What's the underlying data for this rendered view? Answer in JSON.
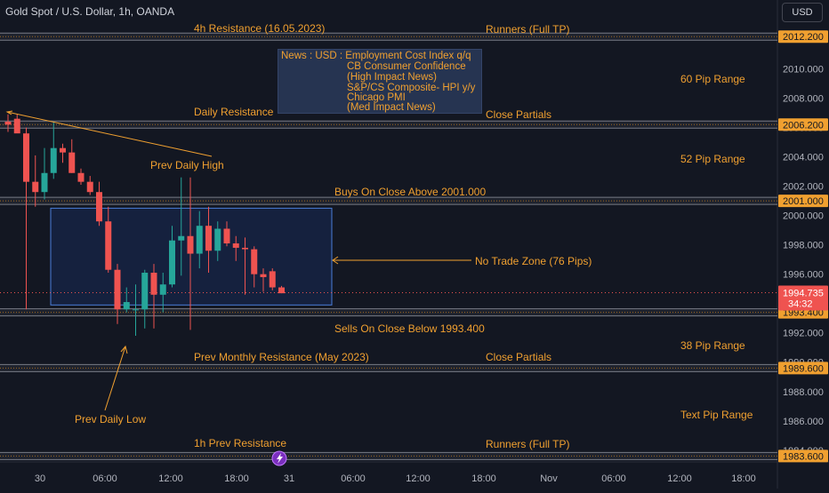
{
  "header": {
    "title": "Gold Spot / U.S. Dollar, 1h, OANDA",
    "currency_button": "USD"
  },
  "colors": {
    "background": "#131722",
    "bull": "#26a69a",
    "bear": "#ef5350",
    "annotation": "#f0a030",
    "zone_line": "#787b86",
    "no_trade_zone": "#2962ff",
    "price_label": "#f0a030",
    "current_price_label": "#ef5350"
  },
  "chart_data": {
    "type": "candlestick",
    "symbol": "Gold Spot / U.S. Dollar",
    "timeframe": "1h",
    "ylim": [
      1983.2,
      2013.0
    ],
    "y_ticks": [
      "2010.000",
      "2008.000",
      "2006.000",
      "2004.000",
      "2002.000",
      "2000.000",
      "1998.000",
      "1996.000",
      "1994.000",
      "1992.000",
      "1990.000",
      "1988.000",
      "1986.000",
      "1984.000"
    ],
    "x_ticks": [
      "30",
      "06:00",
      "12:00",
      "18:00",
      "31",
      "06:00",
      "12:00",
      "18:00",
      "Nov",
      "06:00",
      "12:00",
      "18:00"
    ],
    "price_levels": [
      {
        "price": 2012.2,
        "label": "2012.200"
      },
      {
        "price": 2006.2,
        "label": "2006.200"
      },
      {
        "price": 2001.0,
        "label": "2001.000"
      },
      {
        "price": 1993.4,
        "label": "1993.400"
      },
      {
        "price": 1989.6,
        "label": "1989.600"
      },
      {
        "price": 1983.6,
        "label": "1983.600"
      }
    ],
    "current_price": {
      "price": 1994.735,
      "label": "1994.735",
      "countdown": "34:32"
    },
    "candles": [
      {
        "o": 2006.4,
        "h": 2006.9,
        "l": 2005.7,
        "c": 2006.2
      },
      {
        "o": 2006.6,
        "h": 2006.9,
        "l": 2005.9,
        "c": 2005.6
      },
      {
        "o": 2005.6,
        "h": 2006.0,
        "l": 1993.6,
        "c": 2002.3
      },
      {
        "o": 2002.3,
        "h": 2004.1,
        "l": 2000.6,
        "c": 2001.6
      },
      {
        "o": 2001.6,
        "h": 2004.6,
        "l": 2001.1,
        "c": 2002.9
      },
      {
        "o": 2002.9,
        "h": 2006.4,
        "l": 2002.5,
        "c": 2004.6
      },
      {
        "o": 2004.6,
        "h": 2004.9,
        "l": 2003.6,
        "c": 2004.3
      },
      {
        "o": 2004.3,
        "h": 2005.2,
        "l": 2002.9,
        "c": 2002.9
      },
      {
        "o": 2002.9,
        "h": 2003.2,
        "l": 2002.1,
        "c": 2002.3
      },
      {
        "o": 2002.3,
        "h": 2002.7,
        "l": 2001.4,
        "c": 2001.6
      },
      {
        "o": 2001.6,
        "h": 2002.3,
        "l": 1999.3,
        "c": 1999.6
      },
      {
        "o": 1999.6,
        "h": 2000.6,
        "l": 1996.1,
        "c": 1996.3
      },
      {
        "o": 1996.3,
        "h": 1996.7,
        "l": 1992.6,
        "c": 1993.6
      },
      {
        "o": 1993.6,
        "h": 1995.1,
        "l": 1993.4,
        "c": 1994.1
      },
      {
        "o": 1993.6,
        "h": 1995.3,
        "l": 1991.8,
        "c": 1993.6
      },
      {
        "o": 1993.6,
        "h": 1996.3,
        "l": 1992.3,
        "c": 1996.1
      },
      {
        "o": 1996.1,
        "h": 1996.7,
        "l": 1992.3,
        "c": 1994.6
      },
      {
        "o": 1994.6,
        "h": 1996.1,
        "l": 1993.4,
        "c": 1995.3
      },
      {
        "o": 1995.3,
        "h": 1999.3,
        "l": 1995.1,
        "c": 1998.3
      },
      {
        "o": 1998.3,
        "h": 2002.6,
        "l": 1995.9,
        "c": 1998.6
      },
      {
        "o": 1998.6,
        "h": 2002.6,
        "l": 1992.2,
        "c": 1997.4
      },
      {
        "o": 1997.4,
        "h": 2000.3,
        "l": 1996.4,
        "c": 1999.3
      },
      {
        "o": 1999.3,
        "h": 2000.6,
        "l": 1996.1,
        "c": 1997.6
      },
      {
        "o": 1997.6,
        "h": 1999.6,
        "l": 1996.9,
        "c": 1999.1
      },
      {
        "o": 1999.1,
        "h": 1999.6,
        "l": 1997.9,
        "c": 1998.1
      },
      {
        "o": 1998.1,
        "h": 1998.6,
        "l": 1996.9,
        "c": 1997.8
      },
      {
        "o": 1997.8,
        "h": 1998.5,
        "l": 1994.6,
        "c": 1997.7
      },
      {
        "o": 1997.7,
        "h": 1997.9,
        "l": 1995.1,
        "c": 1996.0
      },
      {
        "o": 1996.0,
        "h": 1996.4,
        "l": 1994.8,
        "c": 1995.8
      },
      {
        "o": 1996.2,
        "h": 1996.4,
        "l": 1994.9,
        "c": 1995.1
      },
      {
        "o": 1995.1,
        "h": 1995.2,
        "l": 1994.7,
        "c": 1994.7
      }
    ]
  },
  "annotations": {
    "res_4h": "4h Resistance (16.05.2023)",
    "runners_top": "Runners (Full TP)",
    "daily_resistance": "Daily Resistance",
    "close_partials_top": "Close Partials",
    "pip_range_60": "60 Pip Range",
    "prev_daily_high": "Prev Daily High",
    "pip_range_52": "52 Pip Range",
    "buys_on_close": "Buys On Close Above 2001.000",
    "no_trade_zone": "No Trade Zone (76 Pips)",
    "sells_on_close": "Sells On Close Below 1993.400",
    "pip_range_38": "38 Pip Range",
    "prev_monthly_res": "Prev Monthly Resistance (May 2023)",
    "close_partials_bottom": "Close Partials",
    "prev_daily_low": "Prev Daily Low",
    "text_pip_range": "Text Pip Range",
    "res_1h_prev": "1h Prev Resistance",
    "runners_bottom": "Runners (Full TP)"
  },
  "news": {
    "line1": "News : USD : Employment Cost Index q/q",
    "line2": "CB Consumer Confidence",
    "line3": "(High Impact News)",
    "line4": "S&P/CS Composite- HPI y/y",
    "line5": "Chicago PMI",
    "line6": "(Med Impact News)"
  },
  "icons": {
    "lightning": "lightning-bolt-icon"
  }
}
